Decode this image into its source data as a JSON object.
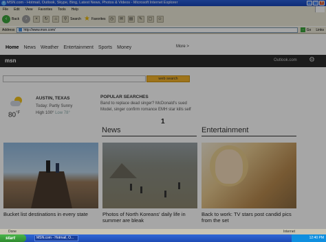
{
  "window": {
    "title": "MSN.com - Hotmail, Outlook, Skype, Bing, Latest News, Photos & Videos - Microsoft Internet Explorer",
    "ie_glyph": "e",
    "controls": [
      "_",
      "□",
      "x"
    ]
  },
  "menu": [
    "File",
    "Edit",
    "View",
    "Favorites",
    "Tools",
    "Help"
  ],
  "toolbar": {
    "back_label": "Back",
    "search_label": "Search",
    "favorites_label": "Favorites"
  },
  "address": {
    "label": "Address",
    "url": "http://www.msn.com/",
    "go_label": "Go",
    "links_label": "Links"
  },
  "nav": {
    "tabs": [
      "Home",
      "News",
      "Weather",
      "Entertainment",
      "Sports",
      "Money"
    ],
    "more": "More >"
  },
  "msnbar": {
    "logo": "msn",
    "outlook": "Outlook.com",
    "gear": "⚙"
  },
  "search": {
    "button": "web search"
  },
  "weather": {
    "city": "AUSTIN, TEXAS",
    "desc": "Today: Partly Sunny",
    "high": "High 100°",
    "low": "Low 78°",
    "temp": "80",
    "unit": "°F"
  },
  "popular": {
    "title": "POPULAR SEARCHES",
    "rows": [
      "Band to replace dead singer?   McDonald's sued",
      "Model, singer confirm romance   EMH star kills self"
    ]
  },
  "sections": {
    "news": "News",
    "entertainment": "Entertainment"
  },
  "cards": [
    {
      "caption": "Bucket list destinations in every state"
    },
    {
      "caption": "Photos of North Koreans' daily life in summer are bleak"
    },
    {
      "caption": "Back to work: TV stars post candid pics from the set"
    }
  ],
  "cursor_glyph": "1",
  "status": {
    "left": "Done",
    "right": "Internet"
  },
  "taskbar": {
    "start": "start",
    "task": "MSN.com - Hotmail, O...",
    "time": "12:40 PM"
  }
}
